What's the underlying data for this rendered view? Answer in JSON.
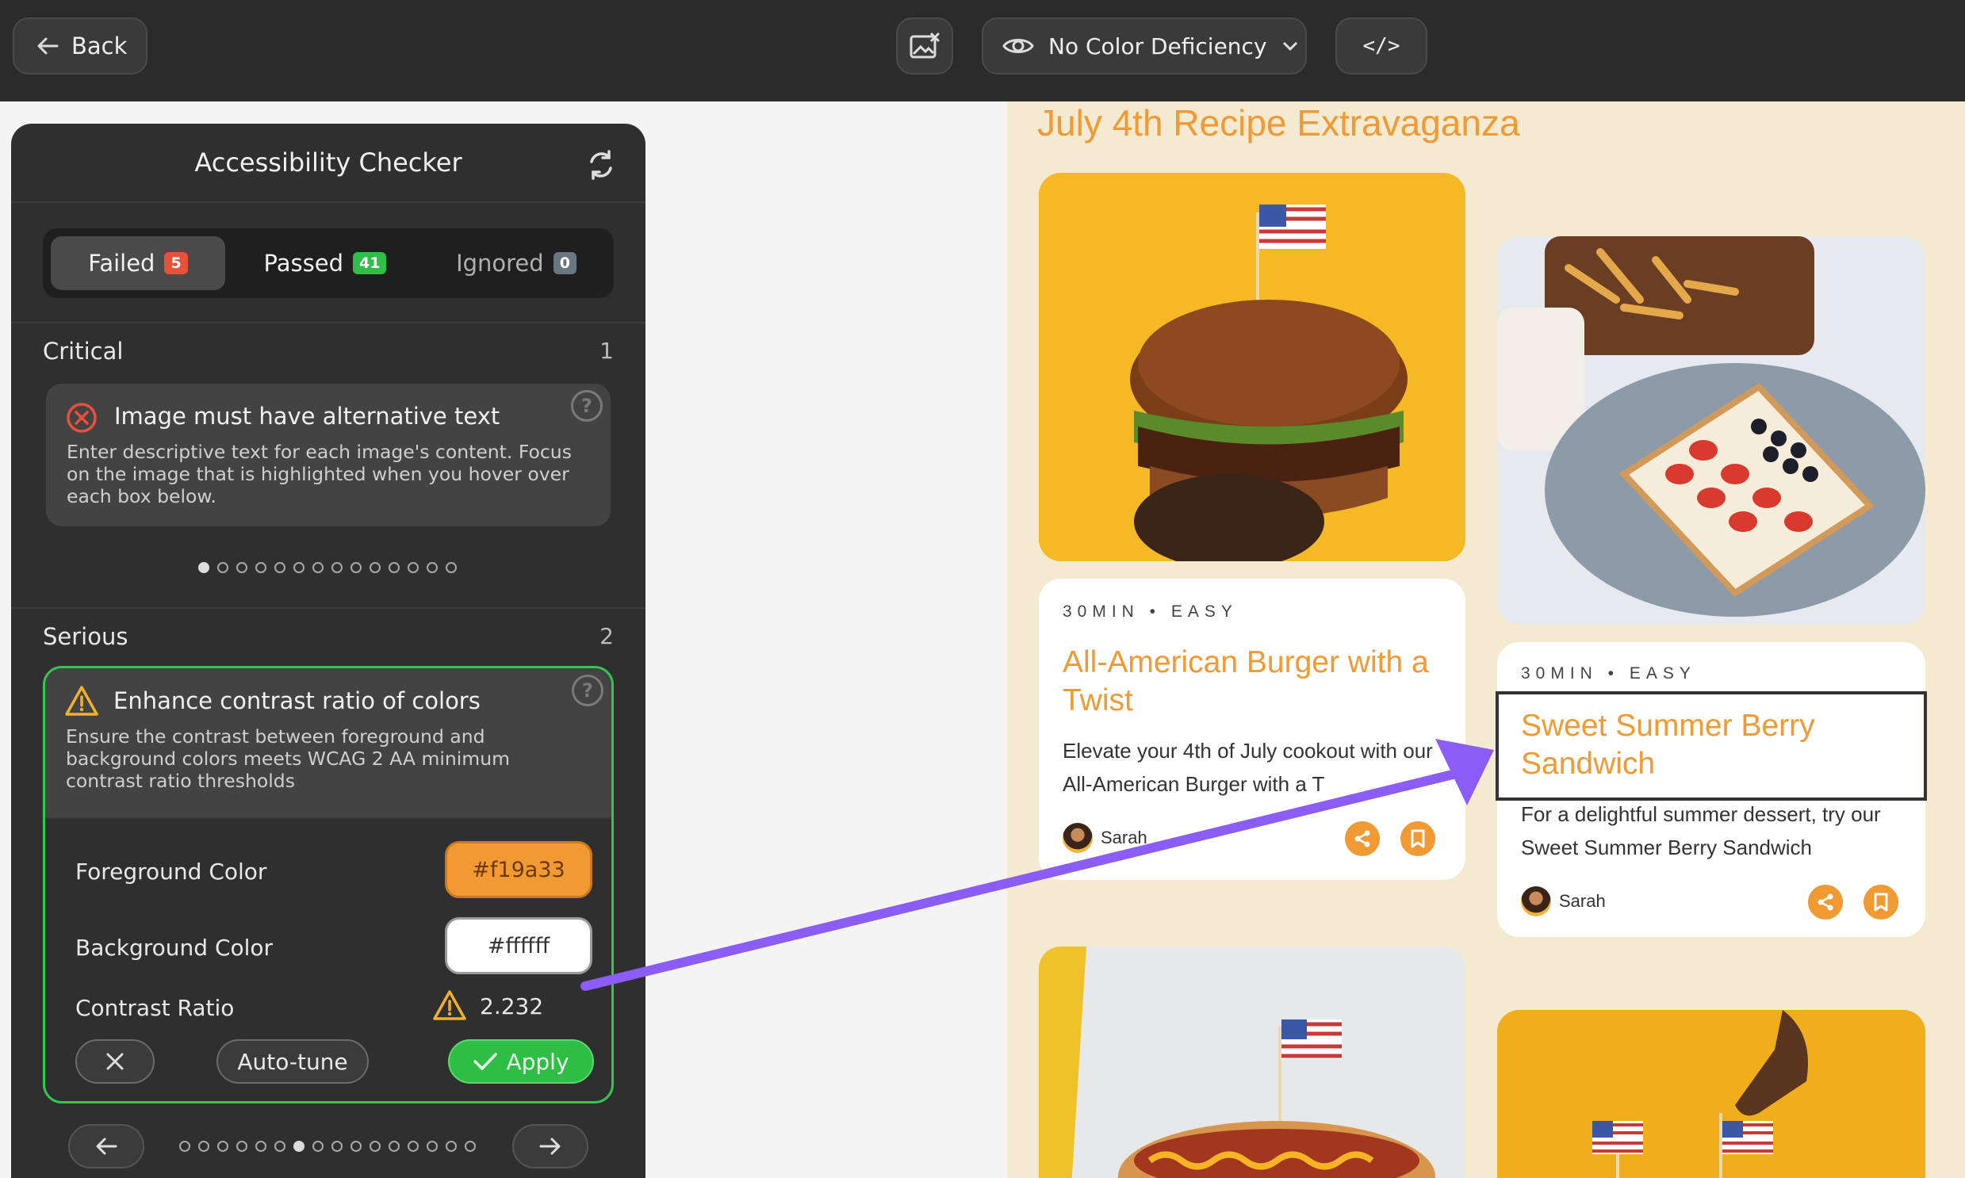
{
  "topbar": {
    "back_label": "Back",
    "color_deficiency": "No Color Deficiency"
  },
  "checker": {
    "title": "Accessibility Checker",
    "tabs": [
      {
        "label": "Failed",
        "count": "5"
      },
      {
        "label": "Passed",
        "count": "41"
      },
      {
        "label": "Ignored",
        "count": "0"
      }
    ],
    "critical": {
      "label": "Critical",
      "count": "1",
      "issue_title": "Image must have alternative text",
      "issue_desc": "Enter descriptive text for each image's content. Focus on the image that is highlighted when you hover over each box below.",
      "pager_total": 14,
      "pager_active": 0
    },
    "serious": {
      "label": "Serious",
      "count": "2",
      "issue_title": "Enhance contrast ratio of colors",
      "issue_desc": "Ensure the contrast between foreground and background colors meets WCAG 2 AA minimum contrast ratio thresholds",
      "fg_label": "Foreground Color",
      "fg_value": "#f19a33",
      "bg_label": "Background Color",
      "bg_value": "#ffffff",
      "ratio_label": "Contrast Ratio",
      "ratio_value": "2.232",
      "autotune_label": "Auto-tune",
      "apply_label": "Apply",
      "pager_total": 16,
      "pager_active": 6
    }
  },
  "site": {
    "title": "July 4th Recipe Extravaganza",
    "recipes": [
      {
        "meta": "30MIN • EASY",
        "title": "All-American Burger with a Twist",
        "desc": "Elevate your 4th of July cookout with our All-American Burger with a T",
        "author": "Sarah"
      },
      {
        "meta": "30MIN • EASY",
        "title": "Sweet Summer Berry Sandwich",
        "desc": "For a delightful summer dessert, try our Sweet Summer Berry Sandwich",
        "author": "Sarah"
      }
    ]
  },
  "colors": {
    "accent": "#f19a33",
    "success": "#34c552",
    "arrow": "#8b5cf6",
    "site_bg": "#f3ead1"
  }
}
